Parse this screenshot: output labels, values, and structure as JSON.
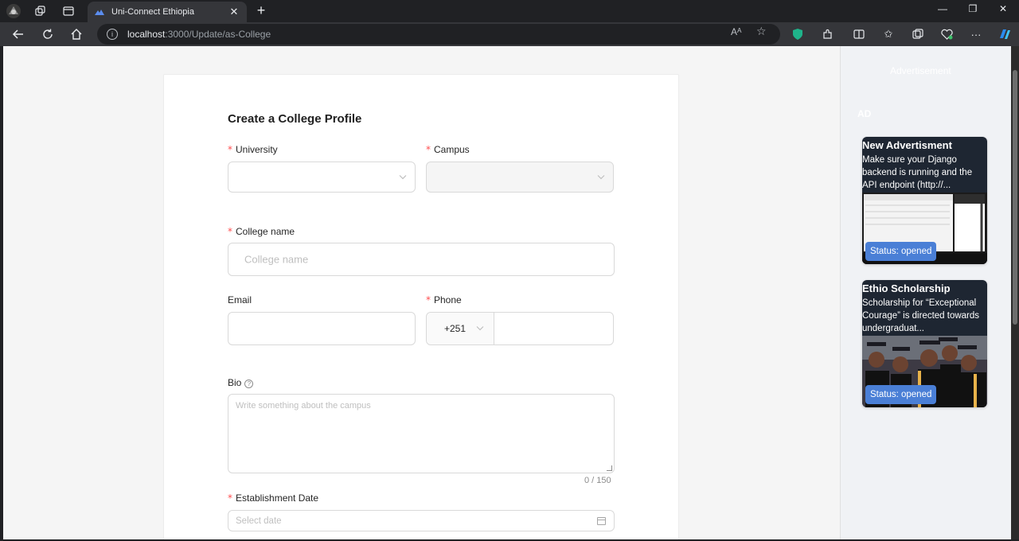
{
  "browser": {
    "tab_title": "Uni-Connect Ethiopia",
    "url_host": "localhost",
    "url_path": ":3000/Update/as-College",
    "read_aloud_label": "Aᴬ"
  },
  "form": {
    "title": "Create a College Profile",
    "university_label": "University",
    "campus_label": "Campus",
    "college_name_label": "College name",
    "college_name_placeholder": "College name",
    "email_label": "Email",
    "phone_label": "Phone",
    "phone_code": "+251",
    "bio_label": "Bio",
    "bio_placeholder": "Write something about the campus",
    "bio_counter": "0 / 150",
    "establishment_label": "Establishment Date",
    "date_placeholder": "Select date",
    "required_mark": "*"
  },
  "ads": {
    "heading": "Advertisement",
    "tag": "AD",
    "items": [
      {
        "title": "New Advertisment",
        "description": "Make sure your Django backend is running and the API endpoint (http://...",
        "status": "Status: opened"
      },
      {
        "title": "Ethio Scholarship",
        "description": "Scholarship for “Exceptional Courage” is directed towards undergraduat...",
        "status": "Status: opened"
      }
    ]
  },
  "colors": {
    "required": "#ff4d4f",
    "status_badge": "#4a7fd6",
    "ad_card_bg": "#1e2632"
  }
}
